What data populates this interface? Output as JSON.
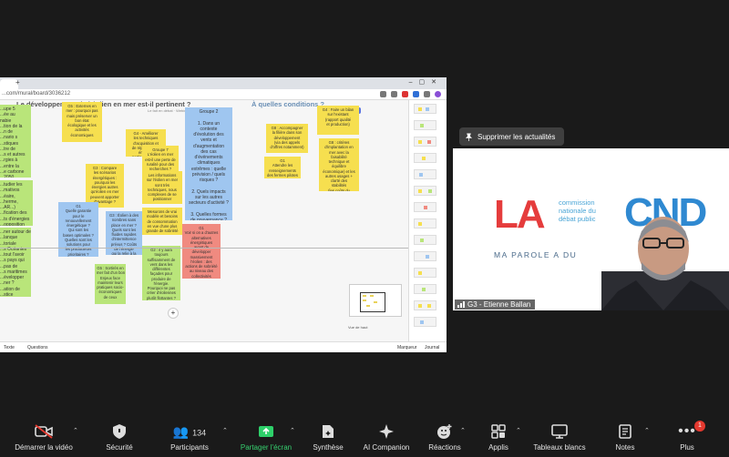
{
  "browser": {
    "url": "...com/mural/board/3036212",
    "board_title": "Le développement de l'éolien en mer est-il pertinent ?",
    "board_title_2": "À quelles conditions ?",
    "board_subtitle": "Le fait en débat · Webinaire AMC 2026",
    "share_label": "Partager",
    "zoom_label": "Vue de haut",
    "tools": [
      "Texte",
      "Questions"
    ],
    "bottom_left": "Texte",
    "bottom_mid": "Questions",
    "bottom_right": [
      "Marqueur",
      "Journal"
    ]
  },
  "stickies": {
    "left": "...upe 5\n...ée au\nnabie\n...tion de la\n...n de\n...nario s\n...stiques\n...tre de\n...s et autres\n...rgies à\n...entre la\n...e carbone\n...2050",
    "left2": "...tudier les\n...mativos\n...éaire,\n...herme,\n...AR...)\n...fication des\n...ts d'énergies\n...opposition",
    "left3": "...ner autour de\n...lanque\n...toriale\n...s Océanies\n...tout l'avoir\n...s pays qui\n...pas de\n...s maritimes\n...évelopper\n...ner ?\n...ation de\n...stice",
    "g5": "G5 : Sortirés en\nmer fait d'un bon\nEnjeux face\nmaintenir leurs\npratiques socio-\néconomiques\nde ceux",
    "g6": "G6 : Les atouts\nen mer bien\néquipés permettront\nquand même de\nse développer",
    "g3": "G3 : Compare\nles scénarios\nénergétiques :\npourquoi les\nénergies autres\nqu'éolien en mer\npeuvent apporter\nd'avantage ?",
    "g1": "G1\nQuelle garantie\npour le\nrenouvellement\nénergétique ?\nQui sont les\nbases optimales ?\nQuelles sont les\nsolutions pour\nles producteurs\nprioritaires ?",
    "g3b": "G3 : Éolien à des\nnombres sans\nplace en mer ?\nQuels sont les\nfluides rapides\nd'intermittence\nprévus ? Coûts\nde l'énergie\nqui la relie à la\nsurface ?",
    "g4": "G4 - Améliorer\nles techniques\nd'acquisition et\nde répondre aux\nénergies\npertinentes pour\nles pêcheurs ?",
    "g7": "Groupe 7\nL'éolien en mer\nest-il une perte de\nruralité pour des\nrecherches ?",
    "yellow_mid": "Les informations\nsur l'éolien en mer\nsont très\ntechniques, nous\ncomplexes de se\npositionner",
    "yellow_mid2": "Mesurons de vrai\nmodèle et besoins\nde consommation\nen vue d'une plus\ngrande de sobriété",
    "g8small": "G2 : il y aura\ntoujours\nsuffisamment de\nvent dans les\ndifférentes\nfaçades pour\nproduire de\nl'énergie.\nPourquoi ne pas\ncréer d'éoliennes\nplutôt flottantes ?",
    "groupe2": "Groupe 2\n\n1. Dans un\ncontexte\nd'évolution des\nvents et\nd'augmentation\ndes cas\nd'événements\nclimatiques\nextrêmes : quelle\nprévision / quels\nrisques ?\n\n2. Quels impacts\nsur les autres\nsecteurs d'activité ?\n\n3. Quelles formes\nde gouvernance ?\nTant au local qu'au\nniveau national",
    "red": "G1\nVoir si on a d'autres\nalternatives\nénergétiques\navant de\ndévelopper\nmassivement\nl'éolien : des\nactions de sobriété\nau niveau des\ncollectivités\npourraient être mises\nen œuvre par ex",
    "g8a": "G8 : Accompagner\nla filière dans son\ndéveloppement\n(via des appels\nd'offres notamment)",
    "g2": "G1\nAttendre les\nrenseignements\ndes fermes pilotes",
    "g4top": "G4 : Faire un bilan\nsur l'existant\n(rapport qualité\net production)",
    "g8b": "G8 : critères\nd'implantation en\nmer avec la\nfaisabilité\ntechnique et\néquilibre\néconomique) et les\nautres usages +\nclarté des\nstabilités\n(les coûts du\ntemps ?)",
    "g5top": "G5 : Externes en\nmer : pourquoi pas\nmais préserver un\nbon état\nécologique et les\nactivités\néconomiques"
  },
  "notification": {
    "text": "Supprimer les actualités",
    "icon": "pin-icon"
  },
  "video": {
    "logo_left": "LA",
    "logo_right": "CND",
    "logo_text": "commission\nnationale du\ndébat public",
    "tagline": "MA PAROLE A DU",
    "participant_name": "G3 - Etienne Ballan"
  },
  "toolbar": {
    "buttons": [
      {
        "label": "Démarrer la vidéo",
        "icon": "video-off-icon"
      },
      {
        "label": "Sécurité",
        "icon": "shield-icon"
      },
      {
        "label": "Participants",
        "icon": "participants-icon",
        "count": "134"
      },
      {
        "label": "Partager l'écran",
        "icon": "share-screen-icon"
      },
      {
        "label": "Synthèse",
        "icon": "summary-icon"
      },
      {
        "label": "AI Companion",
        "icon": "sparkle-icon"
      },
      {
        "label": "Réactions",
        "icon": "reactions-icon"
      },
      {
        "label": "Applis",
        "icon": "apps-icon"
      },
      {
        "label": "Tableaux blancs",
        "icon": "whiteboard-icon"
      },
      {
        "label": "Notes",
        "icon": "notes-icon"
      },
      {
        "label": "Plus",
        "icon": "more-icon"
      }
    ],
    "more_badge": "1",
    "colors": {
      "background": "#1a1a1a",
      "share_green": "#36d06f",
      "badge_red": "#e5392f"
    }
  }
}
